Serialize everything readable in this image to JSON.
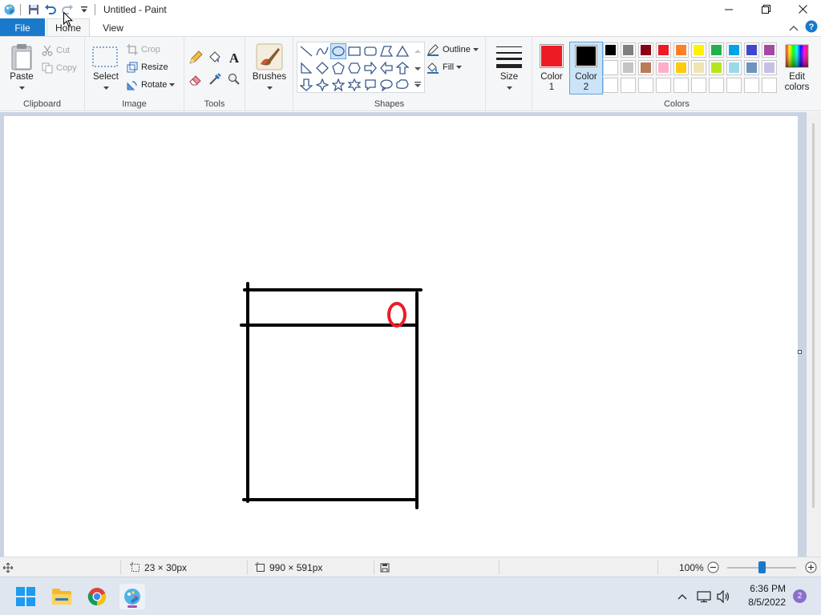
{
  "window": {
    "title": "Untitled - Paint",
    "quick_access": [
      "save-icon",
      "undo-icon",
      "redo-icon",
      "customize-icon"
    ]
  },
  "tabs": {
    "file": "File",
    "home": "Home",
    "view": "View"
  },
  "ribbon": {
    "clipboard": {
      "paste": "Paste",
      "cut": "Cut",
      "copy": "Copy",
      "label": "Clipboard"
    },
    "image": {
      "select": "Select",
      "crop": "Crop",
      "resize": "Resize",
      "rotate": "Rotate",
      "label": "Image"
    },
    "tools": {
      "label": "Tools",
      "icons": [
        "pencil-icon",
        "fill-icon",
        "text-icon",
        "eraser-icon",
        "color-picker-icon",
        "magnifier-icon"
      ]
    },
    "brushes": {
      "label": "Brushes"
    },
    "shapes": {
      "label": "Shapes",
      "outline": "Outline",
      "fill": "Fill",
      "selected": "oval"
    },
    "size": {
      "label": "Size"
    },
    "colors": {
      "label": "Colors",
      "color1_line1": "Color",
      "color1_line2": "1",
      "color2_line1": "Color",
      "color2_line2": "2",
      "color1_value": "#ed1c24",
      "color2_value": "#000000",
      "edit_line1": "Edit",
      "edit_line2": "colors",
      "palette_row1": [
        "#000000",
        "#7f7f7f",
        "#880015",
        "#ed1c24",
        "#ff7f27",
        "#fff200",
        "#22b14c",
        "#00a2e8",
        "#3f48cc",
        "#a349a4"
      ],
      "palette_row2": [
        "#ffffff",
        "#c3c3c3",
        "#b97a57",
        "#ffaec9",
        "#ffc90e",
        "#efe4b0",
        "#b5e61d",
        "#99d9ea",
        "#7092be",
        "#c8bfe7"
      ]
    }
  },
  "status": {
    "selection_size": "23 × 30px",
    "canvas_size": "990 × 591px",
    "zoom": "100%",
    "zoom_fraction": 0.5
  },
  "taskbar": {
    "time": "6:36 PM",
    "date": "8/5/2022",
    "notifications": "2"
  }
}
